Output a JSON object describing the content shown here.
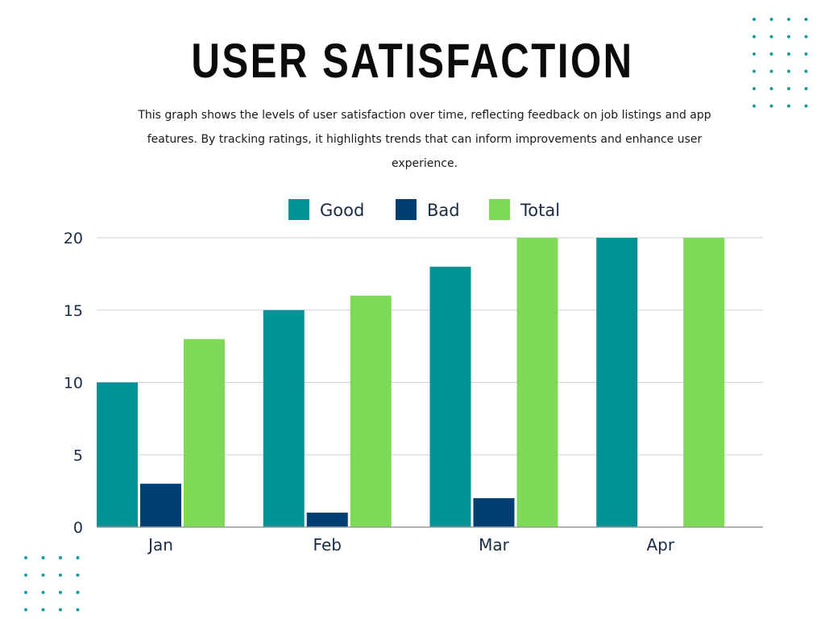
{
  "page": {
    "title": "USER SATISFACTION",
    "subtitle": "This graph shows the levels of user satisfaction over time, reflecting feedback on job listings and app features. By tracking ratings, it highlights trends that can inform improvements and enhance user experience."
  },
  "decor": {
    "dot_color": "#1a9a9a"
  },
  "chart_data": {
    "type": "bar",
    "categories": [
      "Jan",
      "Feb",
      "Mar",
      "Apr"
    ],
    "series": [
      {
        "name": "Good",
        "color": "#009296",
        "values": [
          10,
          15,
          18,
          20
        ]
      },
      {
        "name": "Bad",
        "color": "#003f72",
        "values": [
          3,
          1,
          2,
          0
        ]
      },
      {
        "name": "Total",
        "color": "#7ed957",
        "values": [
          13,
          16,
          20,
          20
        ]
      }
    ],
    "y_ticks": [
      0,
      5,
      10,
      15,
      20
    ],
    "ylim": [
      0,
      20
    ],
    "grid": true,
    "legend_position": "top-center",
    "title": "",
    "xlabel": "",
    "ylabel": ""
  }
}
